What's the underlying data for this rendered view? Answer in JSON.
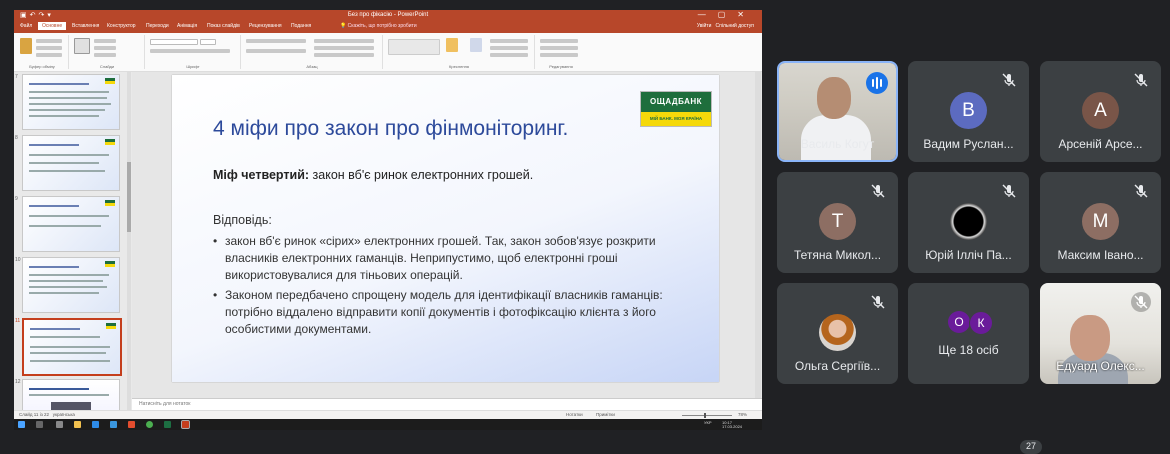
{
  "ppt": {
    "title": "Без про фікасію - PowerPoint",
    "tabs": [
      "Файл",
      "Основне",
      "Вставлення",
      "Конструктор",
      "Переходи",
      "Анімація",
      "Показ слайдів",
      "Рецензування",
      "Подання"
    ],
    "search_hint": "Скажіть, що потрібно зробити",
    "share_label": "Спільний доступ",
    "user_label": "Увійти",
    "ribbon_groups": [
      "Буфер обміну",
      "Слайди",
      "Шрифт",
      "Абзац",
      "Креслення",
      "Редагування"
    ],
    "slide_numbers": [
      "7",
      "8",
      "9",
      "10",
      "11",
      "12"
    ],
    "selected_slide": "11",
    "notes_placeholder": "Натисніть для нотаток",
    "status_left": "Слайд 11 із 22",
    "status_language": "українська",
    "status_notes": "Нотатки",
    "status_comments": "Примітки",
    "zoom": "78%"
  },
  "slide": {
    "title_main": "4 міфи про закон про фінмоніторинг",
    "title_dot": ".",
    "logo_top": "ОЩАДБАНК",
    "logo_bottom": "МІЙ БАНК. МОЯ КРАЇНА",
    "myth_label": "Міф четвертий:",
    "myth_text": " закон вб'є ринок електронних грошей.",
    "answer_label": "Відповідь:",
    "bullets": [
      "закон вб'є ринок «сірих» електронних грошей. Так, закон зобов'язує розкрити власників електронних гаманців. Неприпустимо, щоб електронні гроші використовувалися для тіньових операцій.",
      "Законом передбачено спрощену модель для ідентифікації власників гаманців: потрібно віддалено відправити копії документів і фотофіксацію клієнта з його особистими документами."
    ]
  },
  "taskbar": {
    "time": "10:17",
    "date": "17.03.2024",
    "lang": "УКР"
  },
  "meet": {
    "participants": [
      {
        "name": "Василь Когут",
        "initial": "",
        "muted": false,
        "speaking": true
      },
      {
        "name": "Вадим Руслан...",
        "initial": "В",
        "muted": true,
        "color": "#5c6bc0"
      },
      {
        "name": "Арсеній Арсе...",
        "initial": "А",
        "muted": true,
        "color": "#795548"
      },
      {
        "name": "Тетяна Микол...",
        "initial": "Т",
        "muted": true,
        "color": "#8d6e63"
      },
      {
        "name": "Юрій Ілліч Па...",
        "initial": "",
        "muted": true
      },
      {
        "name": "Максим Івано...",
        "initial": "М",
        "muted": true,
        "color": "#8d6e63"
      },
      {
        "name": "Ольга Сергіїв...",
        "initial": "",
        "muted": true
      },
      {
        "name": "Ще 18 осіб",
        "initial": "",
        "muted": false
      },
      {
        "name": "Едуард Олекс...",
        "initial": "",
        "muted": true
      }
    ],
    "more_avatars": [
      "О",
      "К"
    ],
    "participant_count": "27"
  },
  "colors": {
    "ppt_accent": "#b7472a",
    "oschad_green": "#1e6e3c",
    "oschad_yellow": "#f5d90a",
    "meet_tile": "#3c4043",
    "meet_bg": "#202124"
  }
}
